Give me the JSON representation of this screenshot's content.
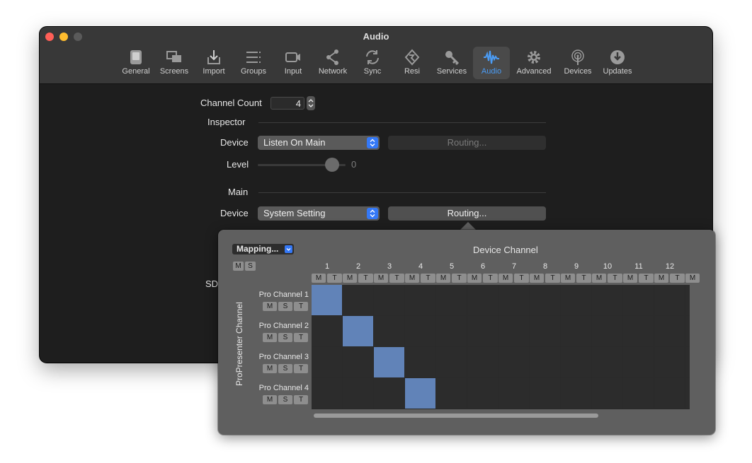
{
  "window": {
    "title": "Audio"
  },
  "toolbar": {
    "items": [
      {
        "label": "General",
        "icon": "general-icon"
      },
      {
        "label": "Screens",
        "icon": "screens-icon"
      },
      {
        "label": "Import",
        "icon": "import-icon"
      },
      {
        "label": "Groups",
        "icon": "groups-icon"
      },
      {
        "label": "Input",
        "icon": "input-icon"
      },
      {
        "label": "Network",
        "icon": "network-icon"
      },
      {
        "label": "Sync",
        "icon": "sync-icon"
      },
      {
        "label": "Resi",
        "icon": "resi-icon"
      },
      {
        "label": "Services",
        "icon": "key-icon"
      },
      {
        "label": "Audio",
        "icon": "audio-waveform-icon",
        "active": true
      },
      {
        "label": "Advanced",
        "icon": "gear-icon"
      },
      {
        "label": "Devices",
        "icon": "devices-icon"
      },
      {
        "label": "Updates",
        "icon": "updates-icon"
      }
    ],
    "active_color": "#4b9cf5"
  },
  "settings": {
    "channel_count_label": "Channel Count",
    "channel_count_value": "4",
    "inspector": {
      "section": "Inspector",
      "device_label": "Device",
      "device_value": "Listen On Main",
      "routing_label": "Routing...",
      "level_label": "Level",
      "level_value": "0"
    },
    "main": {
      "section": "Main",
      "device_label": "Device",
      "device_value": "System Setting",
      "routing_label": "Routing..."
    },
    "sd_label": "SD"
  },
  "routing_popover": {
    "mapping_label": "Mapping...",
    "mute_label": "M",
    "solo_label": "S",
    "test_label": "T",
    "device_channel_title": "Device Channel",
    "propresenter_channel_title": "ProPresenter Channel",
    "columns": [
      "1",
      "2",
      "3",
      "4",
      "5",
      "6",
      "7",
      "8",
      "9",
      "10",
      "11",
      "12"
    ],
    "rows": [
      "Pro Channel 1",
      "Pro Channel 2",
      "Pro Channel 3",
      "Pro Channel 4"
    ],
    "mapping": [
      [
        0,
        0
      ],
      [
        1,
        1
      ],
      [
        2,
        2
      ],
      [
        3,
        3
      ]
    ],
    "active_cell_color": "#6183b8"
  }
}
